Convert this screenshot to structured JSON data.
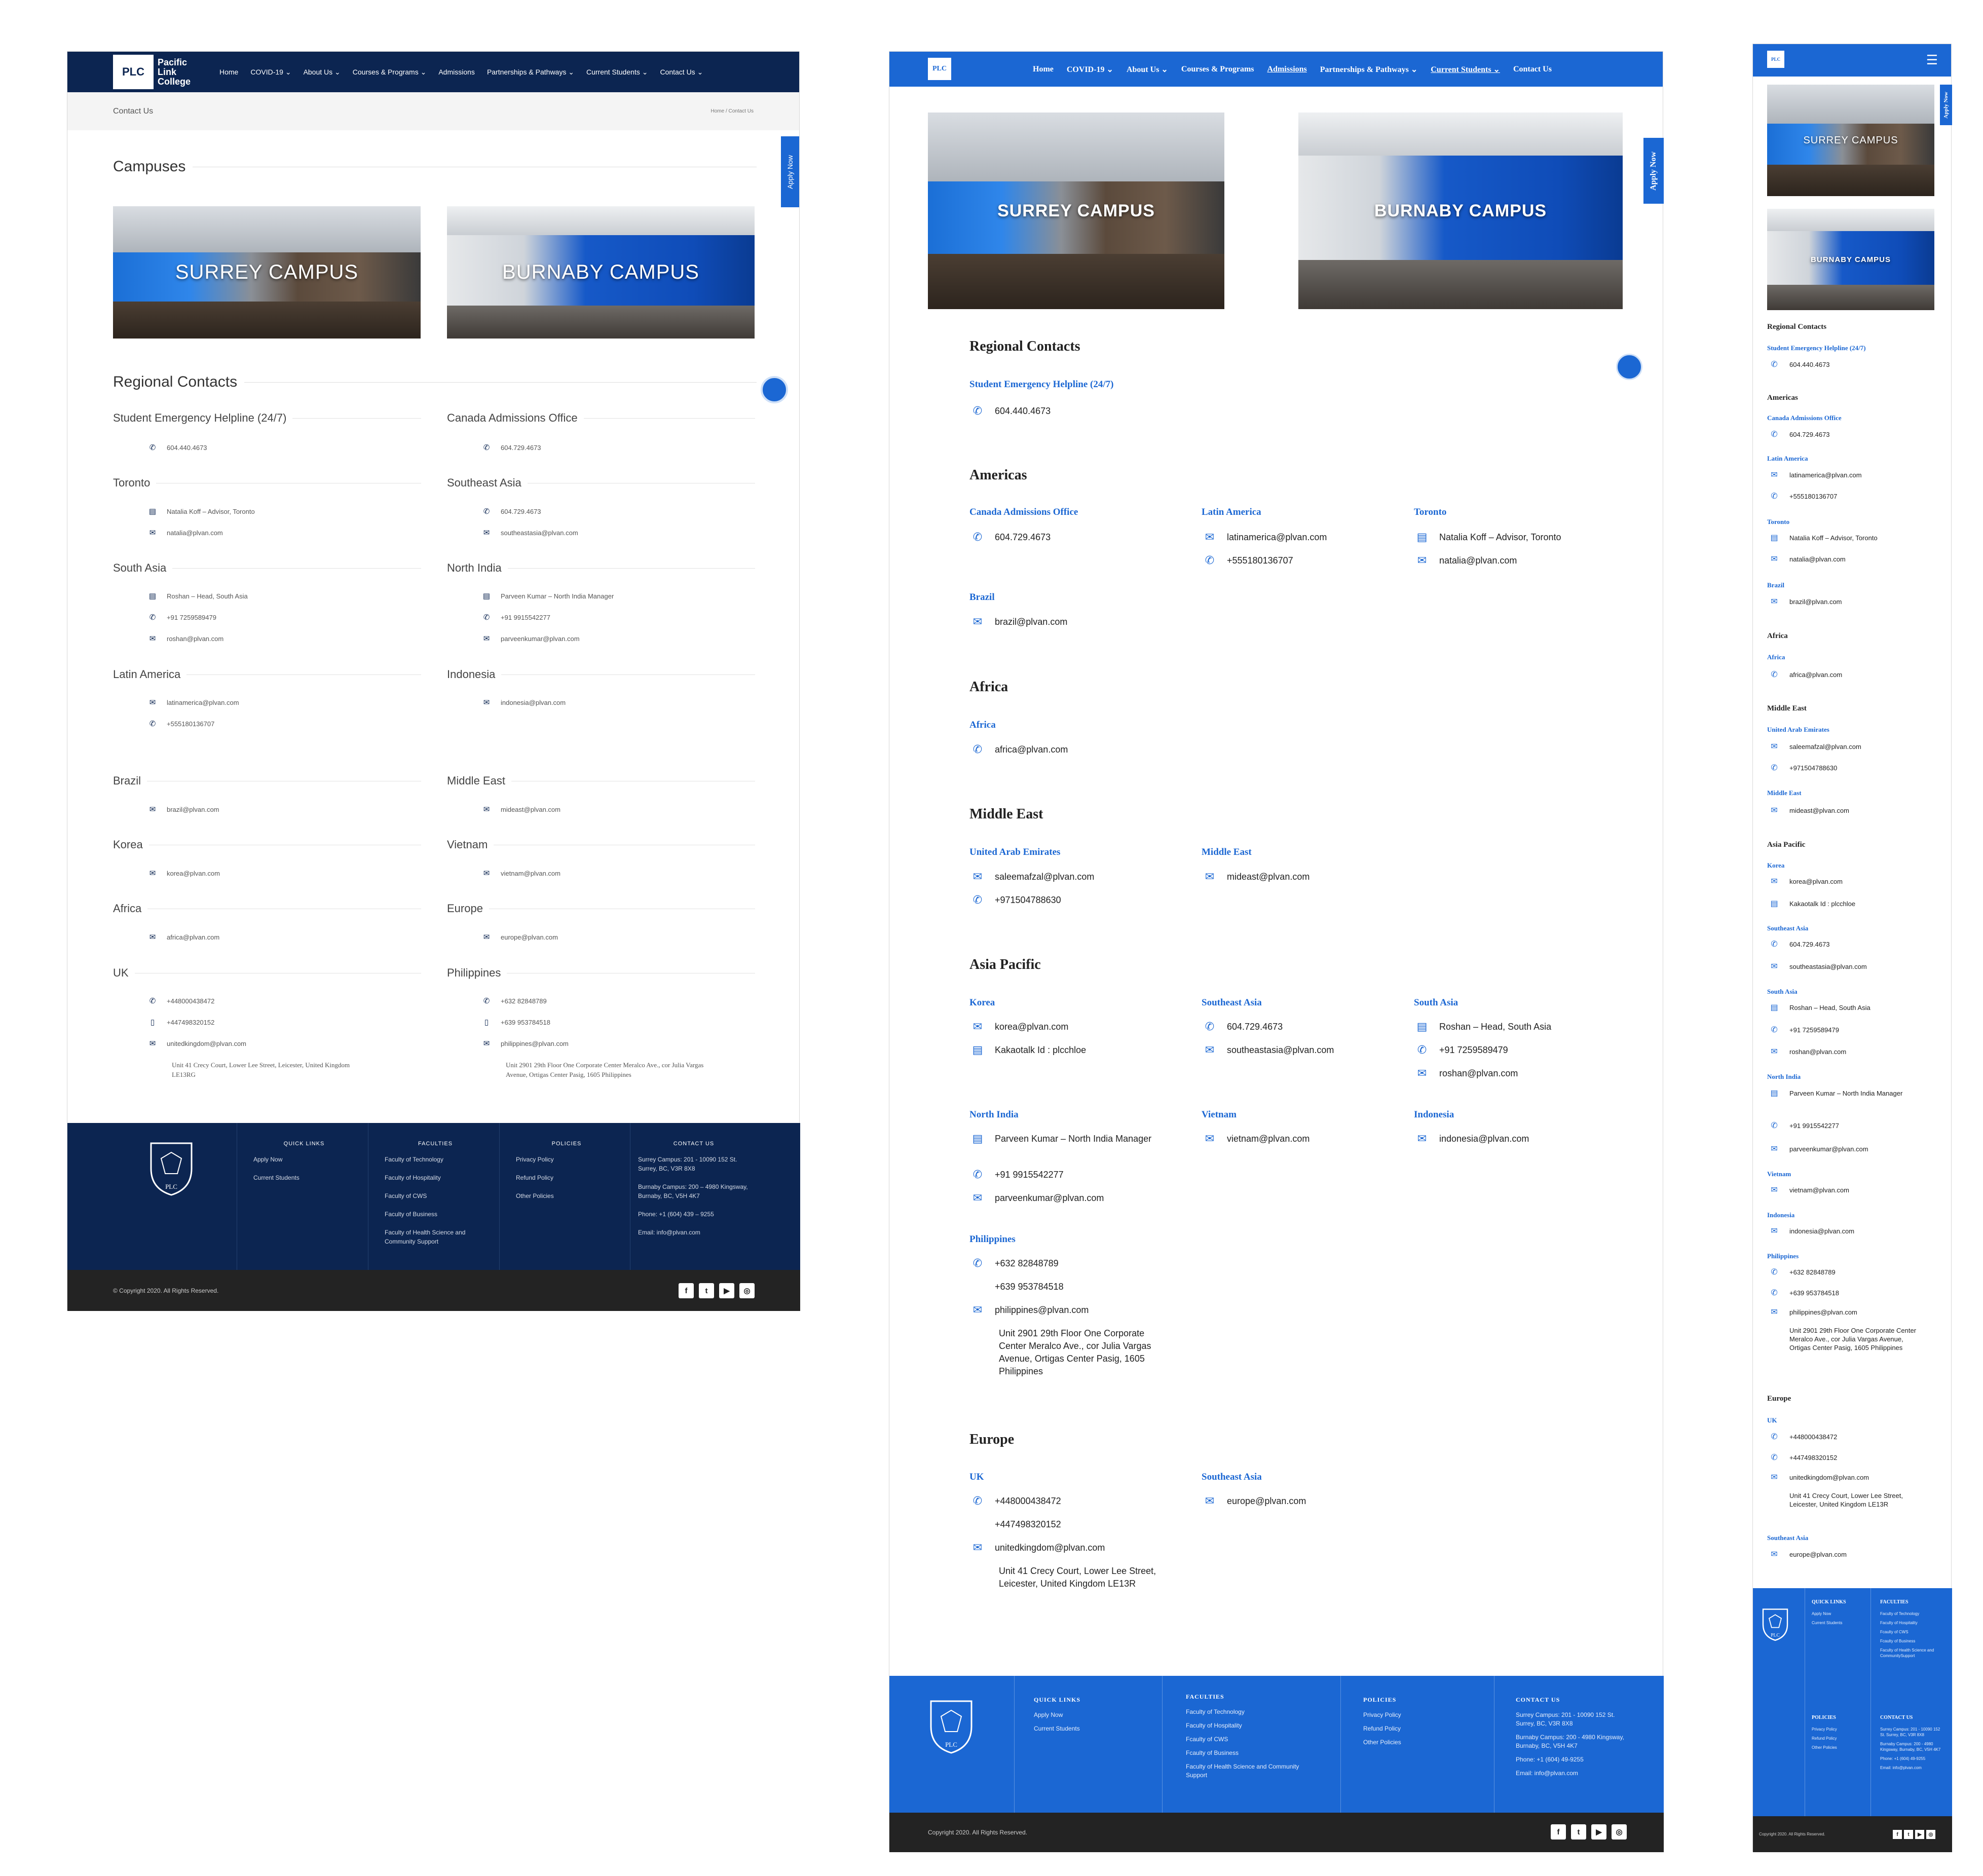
{
  "desktopA": {
    "logo_abbr": "PLC",
    "logo_name": "Pacific Link College",
    "nav": [
      "Home",
      "COVID-19 ⌄",
      "About Us ⌄",
      "Courses & Programs ⌄",
      "Admissions",
      "Partnerships & Pathways ⌄",
      "Current Students ⌄",
      "Contact Us ⌄"
    ],
    "page_title": "Contact Us",
    "breadcrumb": "Home / Contact Us",
    "campuses_title": "Campuses",
    "surrey_label": "SURREY CAMPUS",
    "burnaby_label": "BURNABY CAMPUS",
    "regional_title": "Regional Contacts",
    "apply_now": "Apply Now",
    "groups": {
      "helpline": {
        "title": "Student Emergency Helpline (24/7)",
        "phone": "604.440.4673"
      },
      "canada": {
        "title": "Canada Admissions Office",
        "phone": "604.729.4673"
      },
      "toronto": {
        "title": "Toronto",
        "person": "Natalia Koff – Advisor, Toronto",
        "email": "natalia@plvan.com"
      },
      "seasia": {
        "title": "Southeast Asia",
        "phone": "604.729.4673",
        "email": "southeastasia@plvan.com"
      },
      "southasia": {
        "title": "South Asia",
        "person": "Roshan – Head, South Asia",
        "phone": "+91 7259589479",
        "email": "roshan@plvan.com"
      },
      "northindia": {
        "title": "North India",
        "person": "Parveen Kumar – North India Manager",
        "phone": "+91 9915542277",
        "email": "parveenkumar@plvan.com"
      },
      "latam": {
        "title": "Latin America",
        "email": "latinamerica@plvan.com",
        "phone": "+555180136707"
      },
      "indonesia": {
        "title": "Indonesia",
        "email": "indonesia@plvan.com"
      },
      "brazil": {
        "title": "Brazil",
        "email": "brazil@plvan.com"
      },
      "mideast": {
        "title": "Middle East",
        "email": "mideast@plvan.com"
      },
      "korea": {
        "title": "Korea",
        "email": "korea@plvan.com"
      },
      "vietnam": {
        "title": "Vietnam",
        "email": "vietnam@plvan.com"
      },
      "africa": {
        "title": "Africa",
        "email": "africa@plvan.com"
      },
      "europe": {
        "title": "Europe",
        "email": "europe@plvan.com"
      },
      "uk": {
        "title": "UK",
        "phone": "+448000438472",
        "mobile": "+447498320152",
        "email": "unitedkingdom@plvan.com",
        "address": "Unit 41 Crecy Court, Lower Lee Street, Leicester, United Kingdom LE13RG"
      },
      "philippines": {
        "title": "Philippines",
        "phone": "+632 82848789",
        "mobile": "+639 953784518",
        "email": "philippines@plvan.com",
        "address": "Unit 2901 29th Floor One Corporate Center Meralco Ave., cor Julia Vargas Avenue, Ortigas Center Pasig, 1605 Philippines"
      }
    },
    "footer": {
      "quick_title": "QUICK LINKS",
      "quick": [
        "Apply Now",
        "Current Students"
      ],
      "fac_title": "FACULTIES",
      "faculties": [
        "Faculty of Technology",
        "Faculty of Hospitality",
        "Faculty of CWS",
        "Faculty of Business",
        "Faculty of Health Science and Community Support"
      ],
      "pol_title": "POLICIES",
      "policies": [
        "Privacy Policy",
        "Refund Policy",
        "Other Policies"
      ],
      "contact_title": "CONTACT US",
      "surrey": "Surrey Campus: 201 - 10090 152 St. Surrey, BC, V3R 8X8",
      "burnaby": "Burnaby Campus: 200 – 4980 Kingsway, Burnaby, BC, V5H 4K7",
      "phone": "Phone: +1 (604) 439 – 9255",
      "email": "Email: info@plvan.com",
      "copyright": "© Copyright 2020. All Rights Reserved.",
      "crest": "PLC"
    }
  },
  "desktopB": {
    "logo_abbr": "PLC",
    "nav": [
      "Home",
      "COVID-19 ⌄",
      "About Us ⌄",
      "Courses & Programs",
      "Admissions",
      "Partnerships & Pathways ⌄",
      "Current Students ⌄",
      "Contact Us"
    ],
    "surrey_label": "SURREY CAMPUS",
    "burnaby_label": "BURNABY CAMPUS",
    "apply_now": "Apply Now",
    "regional_title": "Regional Contacts",
    "helpline_title": "Student Emergency Helpline (24/7)",
    "helpline_phone": "604.440.4673",
    "americas_title": "Americas",
    "canada_title": "Canada Admissions Office",
    "canada_phone": "604.729.4673",
    "latam_title": "Latin America",
    "latam_email": "latinamerica@plvan.com",
    "latam_phone": "+555180136707",
    "toronto_title": "Toronto",
    "toronto_person": "Natalia Koff – Advisor, Toronto",
    "toronto_email": "natalia@plvan.com",
    "brazil_title": "Brazil",
    "brazil_email": "brazil@plvan.com",
    "africa_region": "Africa",
    "africa_title": "Africa",
    "africa_email": "africa@plvan.com",
    "mideast_region": "Middle East",
    "uae_title": "United Arab Emirates",
    "uae_email": "saleemafzal@plvan.com",
    "uae_phone": "+971504788630",
    "mideast_title": "Middle East",
    "mideast_email": "mideast@plvan.com",
    "apac_title": "Asia Pacific",
    "korea_title": "Korea",
    "korea_email": "korea@plvan.com",
    "korea_kakao": "Kakaotalk Id : plcchloe",
    "seasia_title": "Southeast Asia",
    "seasia_phone": "604.729.4673",
    "seasia_email": "southeastasia@plvan.com",
    "southasia_title": "South Asia",
    "southasia_person": "Roshan – Head, South Asia",
    "southasia_phone": "+91 7259589479",
    "southasia_email": "roshan@plvan.com",
    "northindia_title": "North India",
    "northindia_person": "Parveen Kumar – North India Manager",
    "northindia_phone": "+91 9915542277",
    "northindia_email": "parveenkumar@plvan.com",
    "vietnam_title": "Vietnam",
    "vietnam_email": "vietnam@plvan.com",
    "indonesia_title": "Indonesia",
    "indonesia_email": "indonesia@plvan.com",
    "phil_title": "Philippines",
    "phil_phone": "+632 82848789",
    "phil_mobile": "+639 953784518",
    "phil_email": "philippines@plvan.com",
    "phil_address": "Unit 2901 29th Floor One Corporate Center Meralco Ave., cor Julia Vargas Avenue, Ortigas Center Pasig, 1605 Philippines",
    "europe_region": "Europe",
    "uk_title": "UK",
    "uk_phone": "+448000438472",
    "uk_mobile": "+447498320152",
    "uk_email": "unitedkingdom@plvan.com",
    "uk_address": "Unit 41 Crecy Court, Lower Lee Street, Leicester, United Kingdom LE13R",
    "eu_title": "Southeast Asia",
    "eu_email": "europe@plvan.com",
    "footer": {
      "quick_title": "QUICK LINKS",
      "quick": [
        "Apply Now",
        "Current Students"
      ],
      "fac_title": "FACULTIES",
      "faculties": [
        "Faculty of Technology",
        "Faculty of  Hospitality",
        "Fcaulty of CWS",
        "Fcaulty of Business",
        "Faculty of Health Science and Community Support"
      ],
      "pol_title": "POLICIES",
      "policies": [
        "Privacy Policy",
        "Refund Policy",
        "Other Policies"
      ],
      "contact_title": "CONTACT US",
      "surrey": "Surrey Campus: 201 - 10090 152 St. Surrey, BC, V3R 8X8",
      "burnaby": "Burnaby Campus: 200 - 4980 Kingsway, Burnaby, BC, V5H 4K7",
      "phone": "Phone: +1 (604) 49-9255",
      "email": "Email: info@plvan.com",
      "copyright": "Copyright 2020. All Rights Reserved.",
      "crest": "PLC"
    }
  },
  "mobile": {
    "logo_abbr": "PLC",
    "menu_icon": "☰",
    "surrey_label": "SURREY CAMPUS",
    "burnaby_label": "BURNABY CAMPUS",
    "apply_now": "Apply Now",
    "regional_title": "Regional Contacts",
    "helpline_title": "Student Emergency Helpline (24/7)",
    "helpline_phone": "604.440.4673",
    "americas_title": "Americas",
    "canada_title": "Canada Admissions Office",
    "canada_phone": "604.729.4673",
    "latam_title": "Latin America",
    "latam_email": "latinamerica@plvan.com",
    "latam_phone": "+555180136707",
    "toronto_title": "Toronto",
    "toronto_person": "Natalia Koff – Advisor, Toronto",
    "toronto_email": "natalia@plvan.com",
    "brazil_title": "Brazil",
    "brazil_email": "brazil@plvan.com",
    "africa_region": "Africa",
    "africa_title": "Africa",
    "africa_email": "africa@plvan.com",
    "mideast_region": "Middle East",
    "uae_title": "United Arab Emirates",
    "uae_email": "saleemafzal@plvan.com",
    "uae_phone": "+971504788630",
    "mideast_title": "Middle East",
    "mideast_email": "mideast@plvan.com",
    "apac_title": "Asia Pacific",
    "korea_title": "Korea",
    "korea_email": "korea@plvan.com",
    "korea_kakao": "Kakaotalk Id : plcchloe",
    "seasia_title": "Southeast Asia",
    "seasia_phone": "604.729.4673",
    "seasia_email": "southeastasia@plvan.com",
    "southasia_title": "South Asia",
    "southasia_person": "Roshan – Head, South Asia",
    "southasia_phone": "+91 7259589479",
    "southasia_email": "roshan@plvan.com",
    "northindia_title": "North India",
    "northindia_person": "Parveen Kumar – North India Manager",
    "northindia_phone": "+91 9915542277",
    "northindia_email": "parveenkumar@plvan.com",
    "vietnam_title": "Vietnam",
    "vietnam_email": "vietnam@plvan.com",
    "indonesia_title": "Indonesia",
    "indonesia_email": "indonesia@plvan.com",
    "phil_title": "Philippines",
    "phil_phone": "+632 82848789",
    "phil_mobile": "+639 953784518",
    "phil_email": "philippines@plvan.com",
    "phil_address": "Unit 2901 29th Floor One Corporate Center Meralco Ave., cor Julia Vargas Avenue, Ortigas Center Pasig, 1605 Philippines",
    "europe_region": "Europe",
    "uk_title": "UK",
    "uk_phone": "+448000438472",
    "uk_mobile": "+447498320152",
    "uk_email": "unitedkingdom@plvan.com",
    "uk_address": "Unit 41 Crecy Court, Lower Lee Street, Leicester, United Kingdom LE13R",
    "eu_title": "Southeast Asia",
    "eu_email": "europe@plvan.com",
    "footer": {
      "quick_title": "QUICK LINKS",
      "quick": [
        "Apply Now",
        "Current Students"
      ],
      "fac_title": "FACULTIES",
      "faculties": [
        "Faculty of Technology",
        "Faculty of Hospitality",
        "Fcaulty of CWS",
        "Fcaulty of Business",
        "Faculty of Health Science and CommunitySupport"
      ],
      "pol_title": "POLICIES",
      "policies": [
        "Privacy Policy",
        "Refund Policy",
        "Other Policies"
      ],
      "contact_title": "CONTACT US",
      "surrey": "Surrey Campus: 201 - 10090 152 St. Surrey, BC, V3R 8X8",
      "burnaby": "Burnaby Campus: 200 - 4980 Kingsway, Burnaby, BC, V5H 4K7",
      "phone": "Phone: +1 (604) 49-9255",
      "email": "Email: info@plvan.com",
      "copyright": "Copyright 2020. All Rights Reserved.",
      "crest": "PLC"
    }
  },
  "icons": {
    "phone": "✆",
    "email": "✉",
    "person": "▤",
    "mobile": "▯"
  },
  "social": [
    "f",
    "t",
    "▶",
    "◎"
  ],
  "colors": {
    "navy": "#0c2551",
    "blue": "#1b67d3",
    "dark": "#232323"
  }
}
